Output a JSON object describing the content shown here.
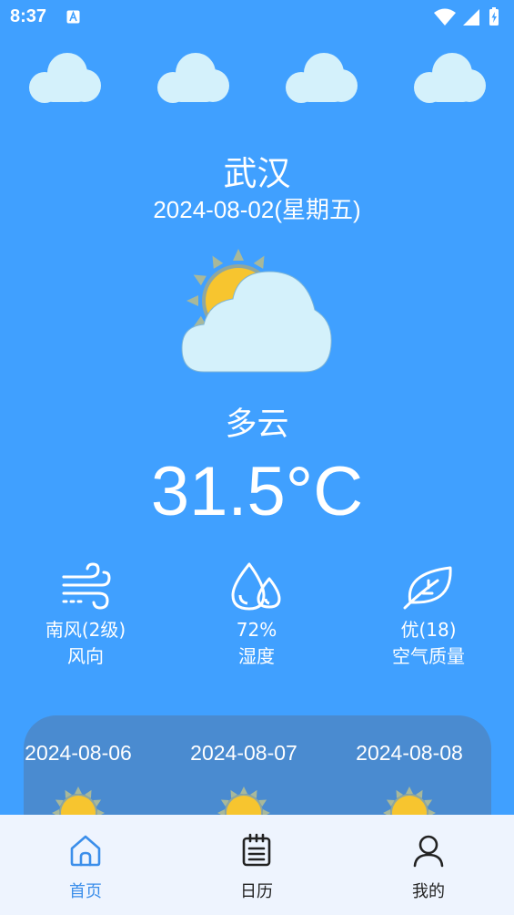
{
  "status_bar": {
    "time": "8:37"
  },
  "weather": {
    "city": "武汉",
    "date": "2024-08-02(星期五)",
    "description": "多云",
    "temperature": "31.5°C"
  },
  "stats": [
    {
      "icon": "wind-icon",
      "value": "南风(2级)",
      "label": "风向"
    },
    {
      "icon": "humidity-icon",
      "value": "72%",
      "label": "湿度"
    },
    {
      "icon": "leaf-icon",
      "value": "优(18)",
      "label": "空气质量"
    }
  ],
  "forecast": [
    {
      "date": "2024-08-06",
      "icon": "sun-icon"
    },
    {
      "date": "2024-08-07",
      "icon": "sun-icon"
    },
    {
      "date": "2024-08-08",
      "icon": "sun-icon"
    }
  ],
  "nav": [
    {
      "label": "首页",
      "icon": "home-icon",
      "active": true
    },
    {
      "label": "日历",
      "icon": "calendar-icon",
      "active": false
    },
    {
      "label": "我的",
      "icon": "user-icon",
      "active": false
    }
  ],
  "colors": {
    "background": "#40A0FF",
    "card": "#4A8BD0",
    "nav_bg": "#EEF4FE",
    "accent": "#3B8EEA",
    "cloud": "#D4F1FB",
    "sun": "#F7C52F"
  }
}
